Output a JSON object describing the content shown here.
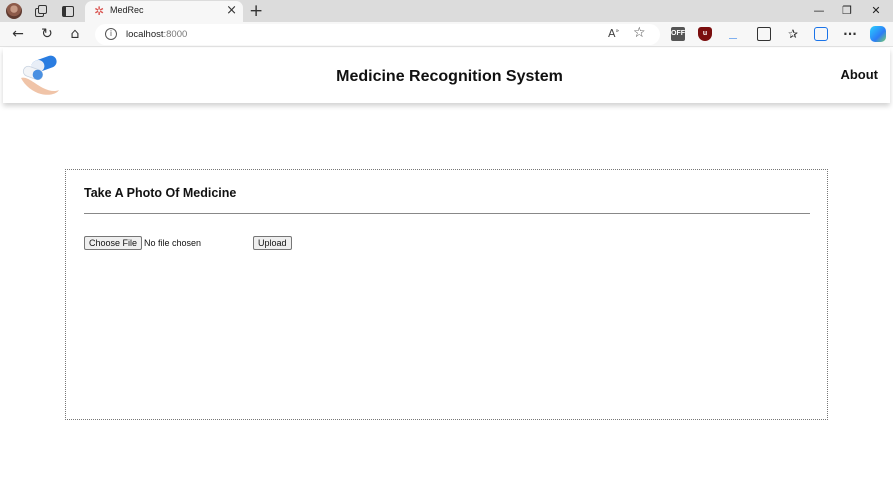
{
  "browser": {
    "tab_title": "MedRec",
    "url_host": "localhost",
    "url_port": ":8000",
    "extensions": {
      "off_label": "OFF"
    },
    "colors": {
      "accent": "#1a73e8",
      "tab_bg": "#f7f7f7",
      "strip_bg": "#dcdcdc"
    }
  },
  "navbar": {
    "title": "Medicine Recognition System",
    "about_label": "About"
  },
  "upload": {
    "heading": "Take A Photo Of Medicine",
    "choose_label": "Choose File",
    "file_status": "No file chosen",
    "upload_label": "Upload"
  },
  "icons": [
    "profile-avatar-icon",
    "workspaces-icon",
    "tab-actions-icon",
    "medrec-favicon-icon",
    "close-icon",
    "plus-icon",
    "back-arrow-icon",
    "reload-icon",
    "home-icon",
    "info-icon",
    "read-aloud-icon",
    "star-icon",
    "extension-off-icon",
    "ublock-icon",
    "download-icon",
    "split-screen-icon",
    "favorites-icon",
    "collections-icon",
    "more-icon",
    "copilot-icon",
    "pill-logo-icon"
  ]
}
